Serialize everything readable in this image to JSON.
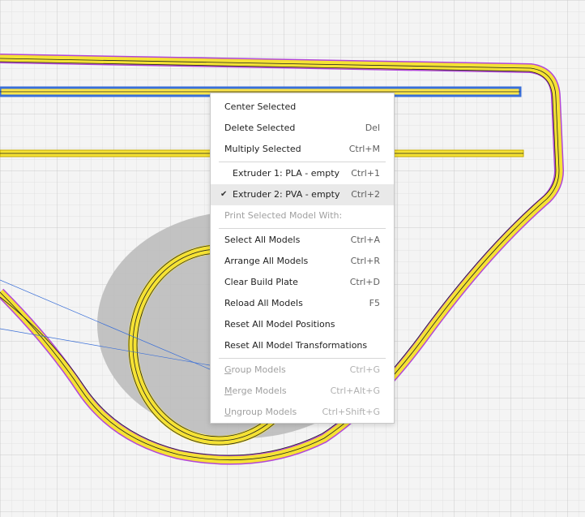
{
  "menu": {
    "items": [
      {
        "label": "Center Selected",
        "shortcut": ""
      },
      {
        "label": "Delete Selected",
        "shortcut": "Del"
      },
      {
        "label": "Multiply Selected",
        "shortcut": "Ctrl+M"
      },
      {
        "label": "Extruder 1: PLA - empty",
        "shortcut": "Ctrl+1"
      },
      {
        "label": "Extruder 2: PVA - empty",
        "shortcut": "Ctrl+2",
        "checked": true
      },
      {
        "label": "Print Selected Model With:",
        "shortcut": ""
      },
      {
        "label": "Select All Models",
        "shortcut": "Ctrl+A"
      },
      {
        "label": "Arrange All Models",
        "shortcut": "Ctrl+R"
      },
      {
        "label": "Clear Build Plate",
        "shortcut": "Ctrl+D"
      },
      {
        "label": "Reload All Models",
        "shortcut": "F5"
      },
      {
        "label": "Reset All Model Positions",
        "shortcut": ""
      },
      {
        "label": "Reset All Model Transformations",
        "shortcut": ""
      },
      {
        "label_first": "G",
        "label_rest": "roup Models",
        "shortcut": "Ctrl+G"
      },
      {
        "label_first": "M",
        "label_rest": "erge Models",
        "shortcut": "Ctrl+Alt+G"
      },
      {
        "label_first": "U",
        "label_rest": "ngroup Models",
        "shortcut": "Ctrl+Shift+G"
      }
    ]
  },
  "colors": {
    "grid_minor": "#e2e2e2",
    "grid_major": "#cfcfcf",
    "shell_outer": "#b145d8",
    "shell_inner": "#f5e234",
    "travel": "#3a6fd8",
    "shadow": "#bdbdbd"
  }
}
